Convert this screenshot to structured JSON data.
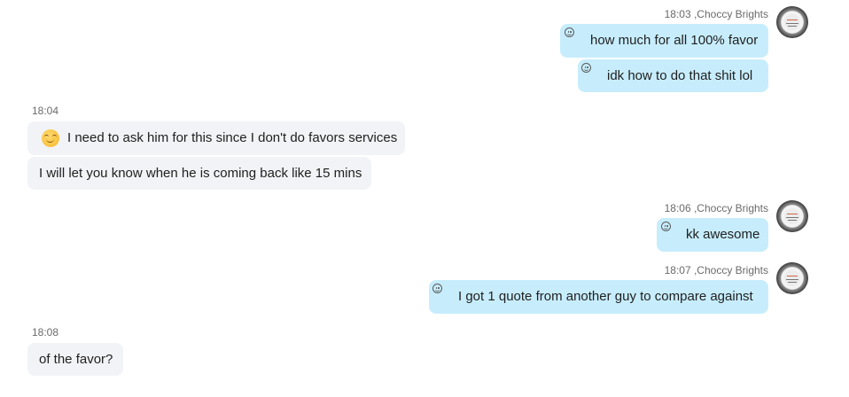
{
  "messages": [
    {
      "meta": {
        "time": "18:03",
        "sender": ",Choccy Brights"
      }
    },
    {
      "text": "how much for all 100% favor"
    },
    {
      "text": "idk how to do that shit lol"
    },
    {
      "meta": {
        "time": "18:04"
      }
    },
    {
      "text": "I need to ask him for this since I don't do favors services",
      "emoji": "smiling-face-emoji"
    },
    {
      "text": "I will let you know when he is coming back like 15 mins"
    },
    {
      "meta": {
        "time": "18:06",
        "sender": ",Choccy Brights"
      }
    },
    {
      "text": "kk awesome"
    },
    {
      "meta": {
        "time": "18:07",
        "sender": ",Choccy Brights"
      }
    },
    {
      "text": "I got 1 quote from another guy to compare against"
    },
    {
      "meta": {
        "time": "18:08"
      }
    },
    {
      "text": "of the favor?"
    }
  ],
  "colors": {
    "outgoing_bubble": "#c7edfc",
    "incoming_bubble": "#f1f3f6",
    "meta_text": "#6b6b6b"
  },
  "icons": {
    "reaction": "smiley-reaction-icon",
    "avatar": "contact-avatar"
  }
}
